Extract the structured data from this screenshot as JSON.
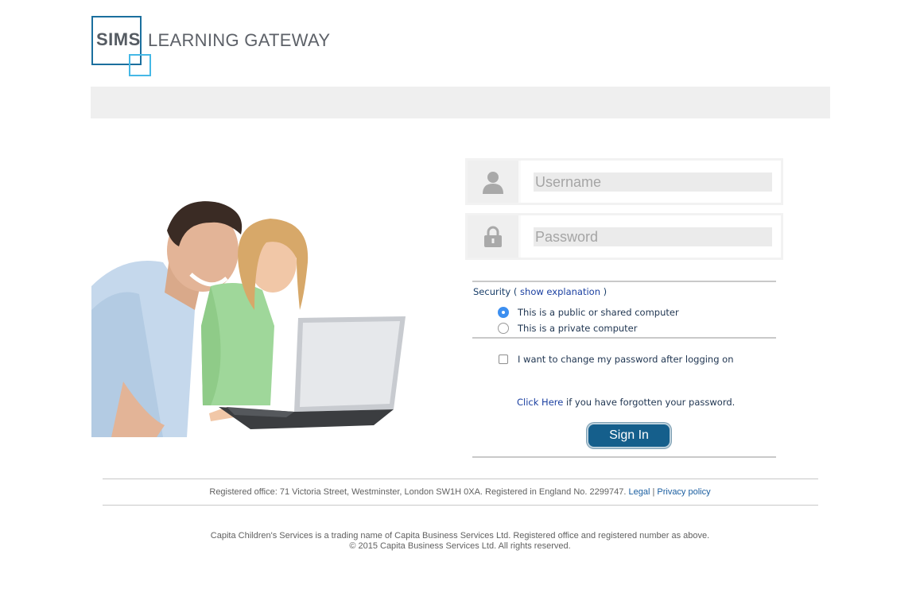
{
  "logo": {
    "sims": "SIMS",
    "text": "LEARNING GATEWAY"
  },
  "login": {
    "username_placeholder": "Username",
    "password_placeholder": "Password",
    "security_label": "Security",
    "security_open": "(",
    "show_explanation": "show explanation",
    "security_close": ")",
    "radio_public": "This is a public or shared computer",
    "radio_private": "This is a private computer",
    "selected_option": "public",
    "change_password_label": "I want to change my password after logging on",
    "forgot_link": "Click Here",
    "forgot_text": "if you have forgotten your password.",
    "signin_label": "Sign In"
  },
  "footer": {
    "registered_office": "Registered office: 71 Victoria Street, Westminster, London SW1H 0XA. Registered in England No. 2299747.",
    "legal_link": "Legal",
    "separator": "|",
    "privacy_link": "Privacy policy",
    "trading_name": "Capita Children's Services is a trading name of Capita Business Services Ltd. Registered office and registered number as above.",
    "copyright": "© 2015 Capita Business Services Ltd. All rights reserved."
  },
  "colors": {
    "accent": "#155f8c",
    "link": "#1a3fa0",
    "logo_dark": "#1b6f9e",
    "logo_light": "#45b8e6",
    "radio_selected": "#3d8ff0"
  },
  "icons": {
    "username": "user-icon",
    "password": "lock-icon"
  }
}
